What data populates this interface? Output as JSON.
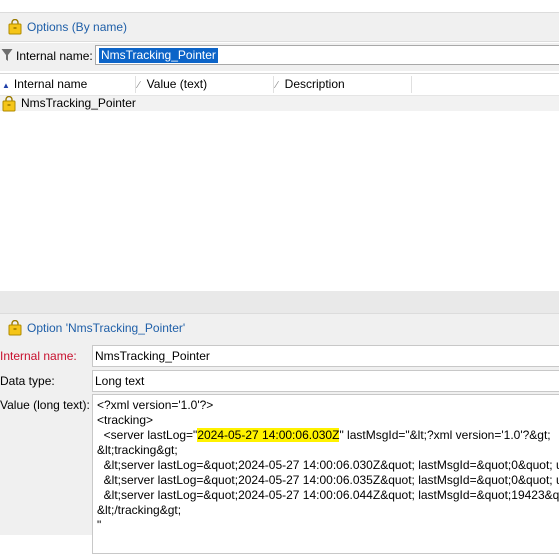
{
  "options_panel": {
    "title": "Options (By name)",
    "filter_label": "Internal name:",
    "filter_value": "NmsTracking_Pointer",
    "columns": [
      "Internal name",
      "Value (text)",
      "Description"
    ],
    "rows": [
      {
        "name": "NmsTracking_Pointer"
      }
    ]
  },
  "option_panel": {
    "title": "Option 'NmsTracking_Pointer'",
    "internal_name_label": "Internal name:",
    "internal_name_value": "NmsTracking_Pointer",
    "data_type_label": "Data type:",
    "data_type_value": "Long text",
    "value_label": "Value (long text):",
    "value_lines": {
      "l1": "<?xml version='1.0'?>",
      "l2": "<tracking>",
      "l3a": "  <server lastLog=\"",
      "l3b": "2024-05-27 14:00:06.030Z",
      "l3c": "\" lastMsgId=\"&lt;?xml version='1.0'?&gt;",
      "l4": "&lt;tracking&gt;",
      "l5": "  &lt;server lastLog=&quot;2024-05-27 14:00:06.030Z&quot; lastMsgId=&quot;0&quot; u",
      "l6": "  &lt;server lastLog=&quot;2024-05-27 14:00:06.035Z&quot; lastMsgId=&quot;0&quot; u",
      "l7": "  &lt;server lastLog=&quot;2024-05-27 14:00:06.044Z&quot; lastMsgId=&quot;19423&qu",
      "l8": "&lt;/tracking&gt;",
      "l9": "\""
    }
  },
  "colors": {
    "title_blue": "#1f5fa8",
    "required_red": "#c8102e",
    "selection_blue": "#0c64c8",
    "highlight_yellow": "#fff200",
    "icon_yellow": "#f5c518"
  }
}
